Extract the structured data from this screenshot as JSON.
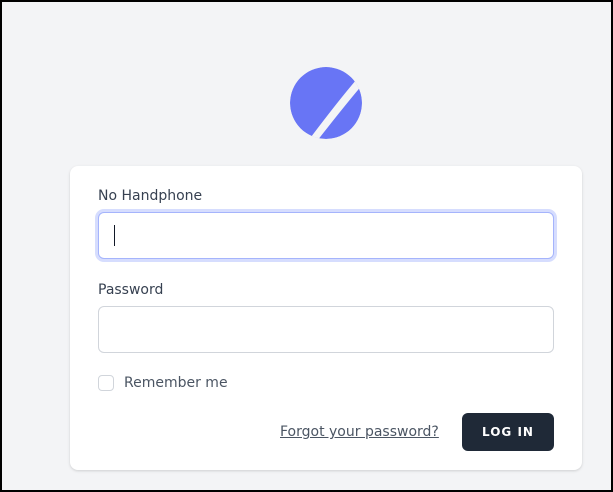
{
  "logo": {
    "icon": "planet-logo-icon",
    "color": "#6875f5"
  },
  "form": {
    "phone": {
      "label": "No Handphone",
      "value": "",
      "placeholder": ""
    },
    "password": {
      "label": "Password",
      "value": "",
      "placeholder": ""
    },
    "remember": {
      "label": "Remember me",
      "checked": false
    },
    "forgot_link": "Forgot your password?",
    "login_button": "Log in"
  },
  "colors": {
    "background": "#f3f4f6",
    "card": "#ffffff",
    "button": "#1f2937",
    "focus_ring": "#a5b4fc"
  }
}
